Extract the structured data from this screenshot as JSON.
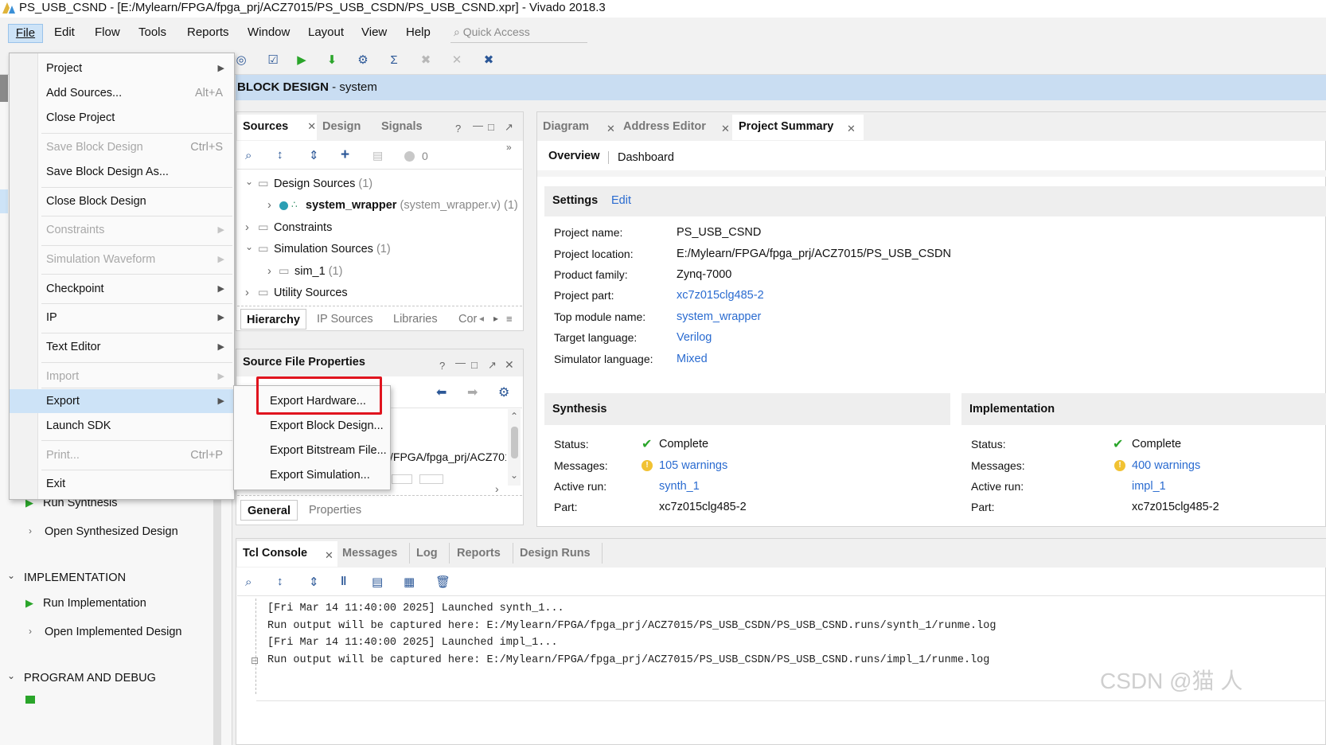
{
  "window": {
    "title": "PS_USB_CSND - [E:/Mylearn/FPGA/fpga_prj/ACZ7015/PS_USB_CSDN/PS_USB_CSND.xpr] - Vivado 2018.3"
  },
  "menubar": {
    "items": [
      "File",
      "Edit",
      "Flow",
      "Tools",
      "Reports",
      "Window",
      "Layout",
      "View",
      "Help"
    ],
    "quick_access_placeholder": "Quick Access"
  },
  "header": {
    "title_bold": "BLOCK DESIGN",
    "title_rest": " - system"
  },
  "file_menu": {
    "project": "Project",
    "add_sources": "Add Sources...",
    "add_sources_shortcut": "Alt+A",
    "close_project": "Close Project",
    "save_block_design": "Save Block Design",
    "save_block_design_shortcut": "Ctrl+S",
    "save_block_design_as": "Save Block Design As...",
    "close_block_design": "Close Block Design",
    "constraints": "Constraints",
    "simulation_waveform": "Simulation Waveform",
    "checkpoint": "Checkpoint",
    "ip": "IP",
    "text_editor": "Text Editor",
    "import": "Import",
    "export": "Export",
    "launch_sdk": "Launch SDK",
    "print": "Print...",
    "print_shortcut": "Ctrl+P",
    "exit": "Exit"
  },
  "export_submenu": {
    "export_hardware": "Export Hardware...",
    "export_block_design": "Export Block Design...",
    "export_bitstream": "Export Bitstream File...",
    "export_simulation": "Export Simulation..."
  },
  "flow_navigator": {
    "run_synthesis": "Run Synthesis",
    "open_synthesized_design": "Open Synthesized Design",
    "implementation_section": "IMPLEMENTATION",
    "run_implementation": "Run Implementation",
    "open_implemented_design": "Open Implemented Design",
    "program_debug_section": "PROGRAM AND DEBUG"
  },
  "sources": {
    "tabs": [
      "Sources",
      "Design",
      "Signals"
    ],
    "count_badge": "0",
    "tree": {
      "design_sources": "Design Sources",
      "design_sources_count": "(1)",
      "system_wrapper": "system_wrapper",
      "system_wrapper_detail": "(system_wrapper.v) (1)",
      "constraints": "Constraints",
      "simulation_sources": "Simulation Sources",
      "simulation_sources_count": "(1)",
      "sim_1": "sim_1",
      "sim_1_count": "(1)",
      "utility_sources": "Utility Sources"
    },
    "bottom_tabs": [
      "Hierarchy",
      "IP Sources",
      "Libraries",
      "Cor"
    ]
  },
  "source_file_properties": {
    "title": "Source File Properties",
    "path_fragment": "/FPGA/fpga_prj/ACZ701",
    "tabs": [
      "General",
      "Properties"
    ]
  },
  "main_tabs": [
    "Diagram",
    "Address Editor",
    "Project Summary"
  ],
  "summary": {
    "subtabs": [
      "Overview",
      "Dashboard"
    ],
    "settings": {
      "title": "Settings",
      "edit": "Edit",
      "rows": [
        {
          "label": "Project name:",
          "value": "PS_USB_CSND"
        },
        {
          "label": "Project location:",
          "value": "E:/Mylearn/FPGA/fpga_prj/ACZ7015/PS_USB_CSDN"
        },
        {
          "label": "Product family:",
          "value": "Zynq-7000"
        },
        {
          "label": "Project part:",
          "value": "xc7z015clg485-2"
        },
        {
          "label": "Top module name:",
          "value": "system_wrapper"
        },
        {
          "label": "Target language:",
          "value": "Verilog"
        },
        {
          "label": "Simulator language:",
          "value": "Mixed"
        }
      ]
    },
    "synthesis": {
      "title": "Synthesis",
      "status_label": "Status:",
      "status": "Complete",
      "messages_label": "Messages:",
      "messages": "105 warnings",
      "active_run_label": "Active run:",
      "active_run": "synth_1",
      "part_label": "Part:",
      "part": "xc7z015clg485-2"
    },
    "implementation": {
      "title": "Implementation",
      "status_label": "Status:",
      "status": "Complete",
      "messages_label": "Messages:",
      "messages": "400 warnings",
      "active_run_label": "Active run:",
      "active_run": "impl_1",
      "part_label": "Part:",
      "part": "xc7z015clg485-2"
    }
  },
  "console": {
    "tabs": [
      "Tcl Console",
      "Messages",
      "Log",
      "Reports",
      "Design Runs"
    ],
    "lines": [
      "[Fri Mar 14 11:40:00 2025] Launched synth_1...",
      "Run output will be captured here: E:/Mylearn/FPGA/fpga_prj/ACZ7015/PS_USB_CSDN/PS_USB_CSND.runs/synth_1/runme.log",
      "[Fri Mar 14 11:40:00 2025] Launched impl_1...",
      "Run output will be captured here: E:/Mylearn/FPGA/fpga_prj/ACZ7015/PS_USB_CSDN/PS_USB_CSND.runs/impl_1/runme.log"
    ]
  },
  "watermark": "CSDN @猫 人"
}
